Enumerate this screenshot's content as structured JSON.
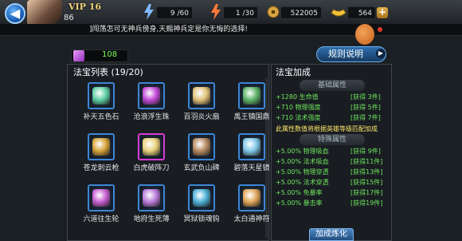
{
  "header": {
    "back_icon": "back-arrow-icon",
    "vip": "VIP 16",
    "level": "86",
    "stamina": "9 /60",
    "energy": "1 /30",
    "copper": "522005",
    "gold": "564"
  },
  "news": "]闯荡怎可无神兵傍身,天赐神兵定是你无悔的选择!",
  "gem_count": "108",
  "rules_button": "规则说明",
  "list_title": "法宝列表 (19/20)",
  "items": [
    {
      "name": "补天五色石",
      "color": "#5fd0a6"
    },
    {
      "name": "沧浪浮生珠",
      "color": "#c44bd8"
    },
    {
      "name": "百羽炎火扇",
      "color": "#e0c27a"
    },
    {
      "name": "禹王镇国鼎",
      "color": "#5fb56b"
    },
    {
      "name": "苍龙刺云枪",
      "color": "#d7a43a"
    },
    {
      "name": "白虎破阵刀",
      "color": "#e7d17c"
    },
    {
      "name": "玄武负山碑",
      "color": "#b78a62"
    },
    {
      "name": "碧落天星镜",
      "color": "#7fc6e6"
    },
    {
      "name": "六道往生轮",
      "color": "#c85fd1"
    },
    {
      "name": "地府生死薄",
      "color": "#b97bd9"
    },
    {
      "name": "冥狱锁魂钩",
      "color": "#4fb0d6"
    },
    {
      "name": "太白通神符",
      "color": "#e0a55a"
    }
  ],
  "bonus": {
    "title": "法宝加成",
    "basic_header": "基础属性",
    "basic": [
      {
        "value": "+1280 生命值",
        "gain": "[获得 3件]"
      },
      {
        "value": "+710 物理强度",
        "gain": "[获得 5件]"
      },
      {
        "value": "+710 法术强度",
        "gain": "[获得 7件]"
      }
    ],
    "note": "此属性数值将根据英雄等级匹配加成",
    "special_header": "特殊属性",
    "special": [
      {
        "value": "+5.00% 物理吸血",
        "gain": "[获得 9件]"
      },
      {
        "value": "+5.00% 法术吸血",
        "gain": "[获得11件]"
      },
      {
        "value": "+5.00% 物理穿透",
        "gain": "[获得13件]"
      },
      {
        "value": "+5.00% 法术穿透",
        "gain": "[获得15件]"
      },
      {
        "value": "+5.00% 免暴率",
        "gain": "[获得17件]"
      },
      {
        "value": "+5.00% 暴击率",
        "gain": "[获得19件]"
      }
    ]
  },
  "combine_button": "加成炼化"
}
